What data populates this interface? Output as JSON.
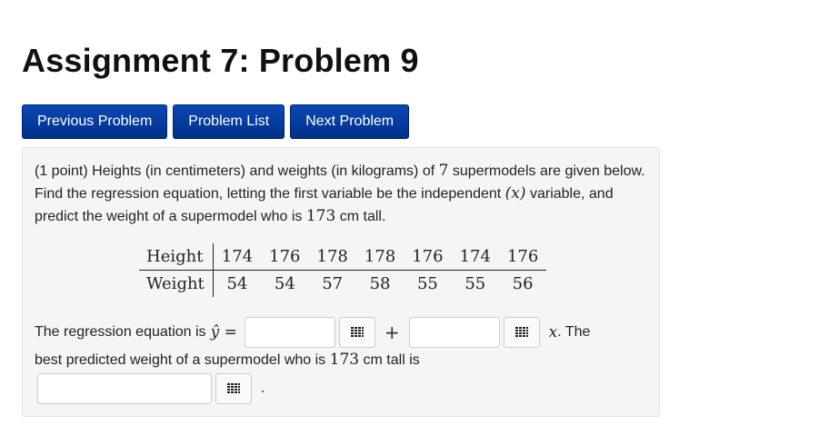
{
  "page": {
    "title": "Assignment 7: Problem 9"
  },
  "nav": {
    "previous": "Previous Problem",
    "list": "Problem List",
    "next": "Next Problem"
  },
  "problem": {
    "points": "(1 point) Heights (in centimeters) and weights (in kilograms) of ",
    "n": "7",
    "text1": " supermodels are given below. Find the regression equation, letting the first variable be the independent ",
    "x_var": "(x)",
    "text2": " variable, and predict the weight of a supermodel who is ",
    "height_value": "173",
    "unit": " cm tall."
  },
  "table": {
    "row1_label": "Height",
    "row2_label": "Weight",
    "heights": [
      "174",
      "176",
      "178",
      "178",
      "176",
      "174",
      "176"
    ],
    "weights": [
      "54",
      "54",
      "57",
      "58",
      "55",
      "55",
      "56"
    ]
  },
  "answer": {
    "eq_prefix": "The regression equation is ",
    "yhat": "ŷ =",
    "plus": "+",
    "x_term": "x",
    "suffix": ". The",
    "line2_prefix": "best predicted weight of a supermodel who is ",
    "line2_value": "173",
    "line2_suffix": " cm tall is",
    "period": ".",
    "input_intercept": "",
    "input_slope": "",
    "input_prediction": ""
  },
  "icons": {
    "equation_editor": "grid-icon"
  }
}
